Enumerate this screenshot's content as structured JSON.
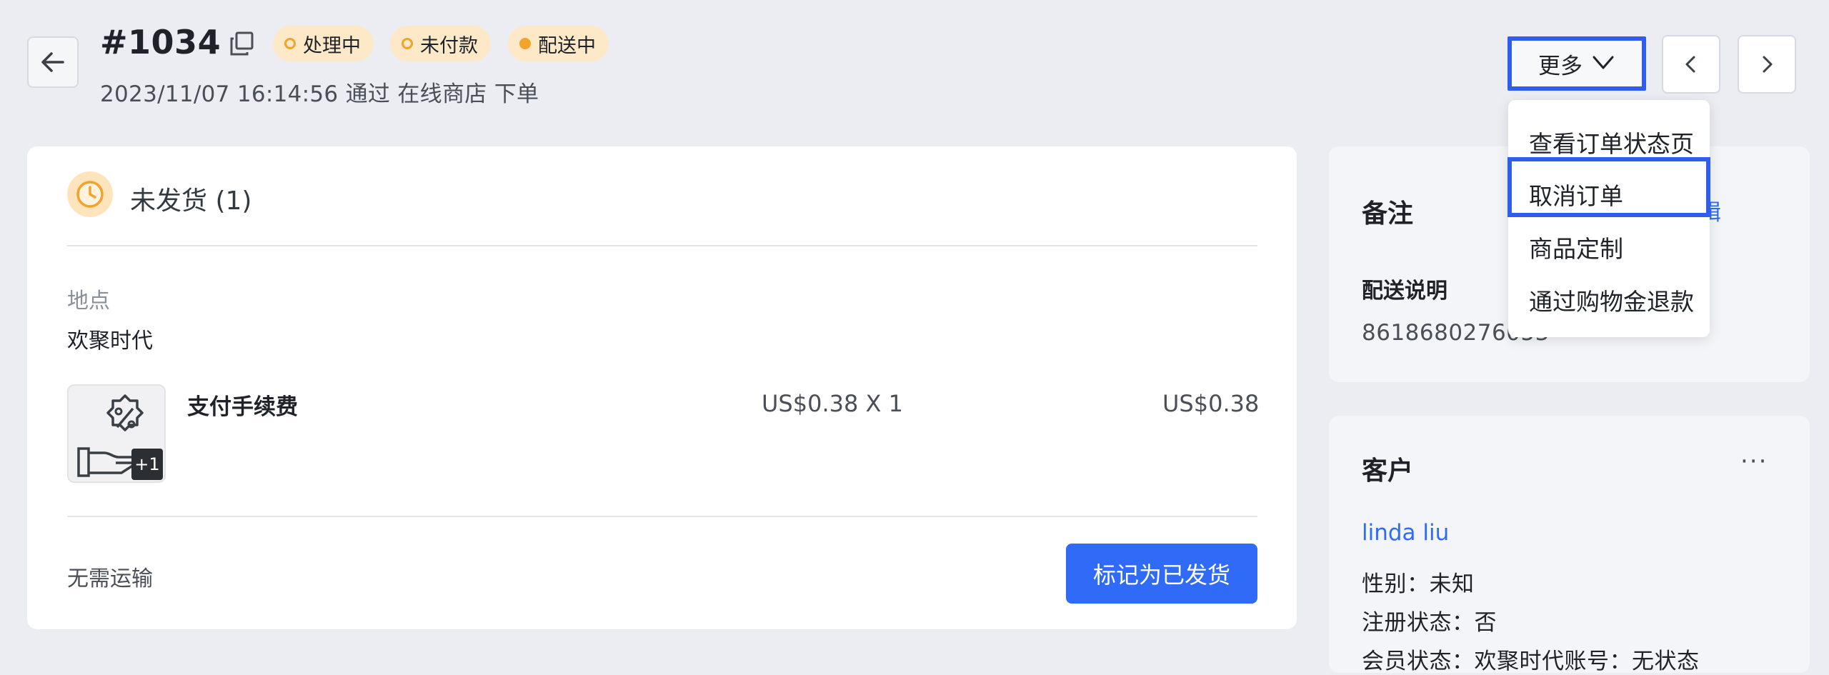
{
  "header": {
    "order_number": "#1034",
    "subtitle": "2023/11/07 16:14:56 通过 在线商店 下单",
    "badges": [
      "处理中",
      "未付款",
      "配送中"
    ],
    "more_label": "更多"
  },
  "more_menu": {
    "items": [
      "查看订单状态页",
      "取消订单",
      "商品定制",
      "通过购物金退款"
    ]
  },
  "fulfillment": {
    "title": "未发货 (1)",
    "location_label": "地点",
    "location_value": "欢聚时代",
    "item": {
      "name": "支付手续费",
      "unit_price": "US$0.38 X 1",
      "total": "US$0.38",
      "extra_count": "+1"
    },
    "shipping_note": "无需运输",
    "mark_shipped_label": "标记为已发货"
  },
  "notes_card": {
    "title": "备注",
    "edit_fragment": "辑",
    "delivery_label": "配送说明",
    "delivery_value": "8618680276053"
  },
  "customer_card": {
    "title": "客户",
    "more": "···",
    "name": "linda liu",
    "gender": "性别：未知",
    "registration": "注册状态：否",
    "membership": "会员状态：欢聚时代账号：无状态"
  },
  "colors": {
    "accent": "#2f6bf6",
    "highlight_border": "#2f5eed",
    "badge_bg": "#fde9c7",
    "badge_dot": "#f1a32c",
    "page_bg": "#ecedf2"
  }
}
